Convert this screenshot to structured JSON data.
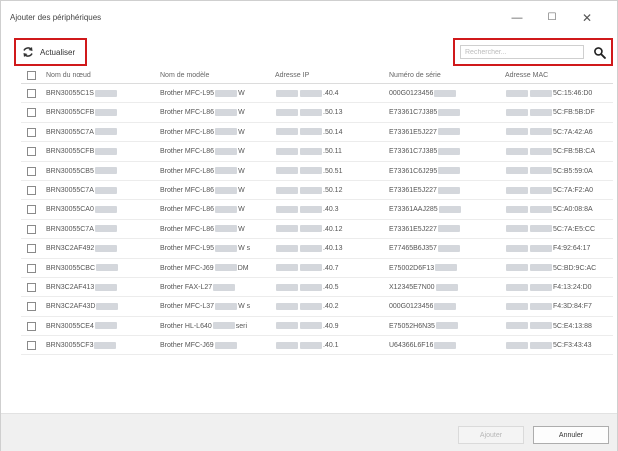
{
  "window": {
    "title": "Ajouter des périphériques",
    "controls": {
      "minimize": "—",
      "maximize": "☐",
      "close": "✕"
    }
  },
  "toolbar": {
    "refresh_label": "Actualiser",
    "search_placeholder": "Rechercher..."
  },
  "table": {
    "columns": {
      "name": "Nom du nœud",
      "model": "Nom de modèle",
      "ip": "Adresse IP",
      "serial": "Numéro de série",
      "mac": "Adresse MAC"
    },
    "rows": [
      {
        "name": "BRN30055C1S",
        "model": "Brother MFC-L95",
        "model_suffix": "W",
        "ip": ".40.4",
        "serial": "000G0123456",
        "mac": "5C:15:46:D0"
      },
      {
        "name": "BRN30055CFB",
        "model": "Brother MFC-L86",
        "model_suffix": "W",
        "ip": ".50.13",
        "serial": "E73361C7J385",
        "mac": "5C:FB:5B:DF"
      },
      {
        "name": "BRN30055C7A",
        "model": "Brother MFC-L86",
        "model_suffix": "W",
        "ip": ".50.14",
        "serial": "E73361E5J227",
        "mac": "5C:7A:42:A6"
      },
      {
        "name": "BRN30055CFB",
        "model": "Brother MFC-L86",
        "model_suffix": "W",
        "ip": ".50.11",
        "serial": "E73361C7J385",
        "mac": "5C:FB:5B:CA"
      },
      {
        "name": "BRN30055CB5",
        "model": "Brother MFC-L86",
        "model_suffix": "W",
        "ip": ".50.51",
        "serial": "E73361C6J295",
        "mac": "5C:B5:59:0A"
      },
      {
        "name": "BRN30055C7A",
        "model": "Brother MFC-L86",
        "model_suffix": "W",
        "ip": ".50.12",
        "serial": "E73361E5J227",
        "mac": "5C:7A:F2:A0"
      },
      {
        "name": "BRN30055CA0",
        "model": "Brother MFC-L86",
        "model_suffix": "W",
        "ip": ".40.3",
        "serial": "E73361AAJ285",
        "mac": "5C:A0:08:8A"
      },
      {
        "name": "BRN30055C7A",
        "model": "Brother MFC-L86",
        "model_suffix": "W",
        "ip": ".40.12",
        "serial": "E73361E5J227",
        "mac": "5C:7A:E5:CC"
      },
      {
        "name": "BRN3C2AF492",
        "model": "Brother MFC-L95",
        "model_suffix": "W s",
        "ip": ".40.13",
        "serial": "E77465B6J357",
        "mac": "F4:92:64:17"
      },
      {
        "name": "BRN30055CBC",
        "model": "Brother MFC-J69",
        "model_suffix": "DM",
        "ip": ".40.7",
        "serial": "E75002D6F13",
        "mac": "5C:BD:9C:AC"
      },
      {
        "name": "BRN3C2AF413",
        "model": "Brother FAX-L27",
        "model_suffix": "",
        "ip": ".40.5",
        "serial": "X12345E7N00",
        "mac": "F4:13:24:D0"
      },
      {
        "name": "BRN3C2AF43D",
        "model": "Brother MFC-L37",
        "model_suffix": "W s",
        "ip": ".40.2",
        "serial": "000G0123456",
        "mac": "F4:3D:84:F7"
      },
      {
        "name": "BRN30055CE4",
        "model": "Brother HL-L640",
        "model_suffix": "seri",
        "ip": ".40.9",
        "serial": "E75052H6N35",
        "mac": "5C:E4:13:88"
      },
      {
        "name": "BRN30055CF3",
        "model": "Brother MFC-J69",
        "model_suffix": "",
        "ip": ".40.1",
        "serial": "U64366L6F16",
        "mac": "5C:F3:43:43"
      }
    ]
  },
  "footer": {
    "add_label": "Ajouter",
    "cancel_label": "Annuler"
  }
}
